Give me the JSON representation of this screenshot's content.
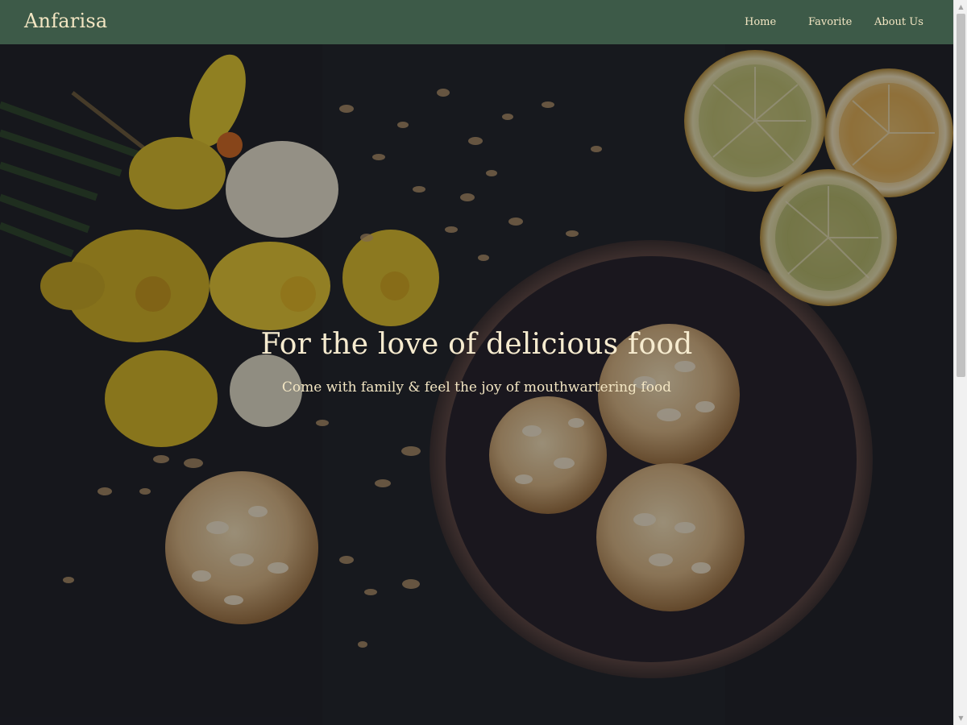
{
  "navbar": {
    "brand": "Anfarisa",
    "links": [
      {
        "label": "Home"
      },
      {
        "label": "Favorite"
      },
      {
        "label": "About Us"
      }
    ]
  },
  "hero": {
    "title": "For the love of delicious food",
    "subtitle": "Come with family & feel the joy of mouthwartering food"
  },
  "colors": {
    "navbar_bg": "#3d5a48",
    "accent_text": "#f3e6c3",
    "hero_bg": "#17181d"
  },
  "icons": {
    "scroll_up": "chevron-up-icon",
    "scroll_down": "chevron-down-icon"
  }
}
